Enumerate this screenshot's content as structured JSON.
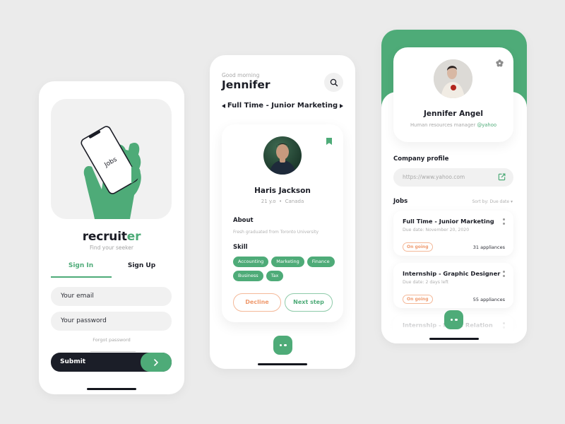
{
  "colors": {
    "accent": "#4eab78",
    "dark": "#1b1e28",
    "warning": "#ef9a6e",
    "background": "#ebebeb"
  },
  "signin_screen": {
    "hero_phone_text": "Jobs",
    "logo_main": "recruit",
    "logo_accent": "er",
    "tagline": "Find your seeker",
    "tabs": [
      {
        "label": "Sign In",
        "active": true
      },
      {
        "label": "Sign Up",
        "active": false
      }
    ],
    "email_placeholder": "Your email",
    "password_placeholder": "Your password",
    "forgot_label": "Forgot password",
    "submit_label": "Submit",
    "submit_icon": "chevron-right-icon"
  },
  "candidate_screen": {
    "greeting": "Good morning",
    "user_name": "Jennifer",
    "search_icon": "search-icon",
    "job_title": "Full Time - Junior Marketing",
    "candidate": {
      "name": "Haris Jackson",
      "age": "21 y.o",
      "separator": "•",
      "location": "Canada",
      "about_heading": "About",
      "about_text": "Fresh graduated from Toronto University",
      "skill_heading": "Skill",
      "skills": [
        "Accounting",
        "Marketing",
        "Finance",
        "Business",
        "Tax"
      ],
      "bookmarked": true
    },
    "decline_label": "Decline",
    "next_label": "Next step"
  },
  "profile_screen": {
    "name": "Jennifer Angel",
    "role": "Human resources manager",
    "handle": "@yahoo",
    "company_heading": "Company profile",
    "company_url": "https://www.yahoo.com",
    "jobs_heading": "Jobs",
    "sort_label": "Sort by: Due date ▾",
    "jobs": [
      {
        "title": "Full Time - Junior Marketing",
        "due": "Due date: November 20, 2020",
        "status": "On going",
        "appliances": "31 appliances"
      },
      {
        "title": "Internship - Graphic Designer",
        "due": "Due date: 2 days left",
        "status": "On going",
        "appliances": "55 appliances"
      },
      {
        "title": "Internship - Public Relation",
        "due": "",
        "status": "",
        "appliances": ""
      }
    ]
  }
}
